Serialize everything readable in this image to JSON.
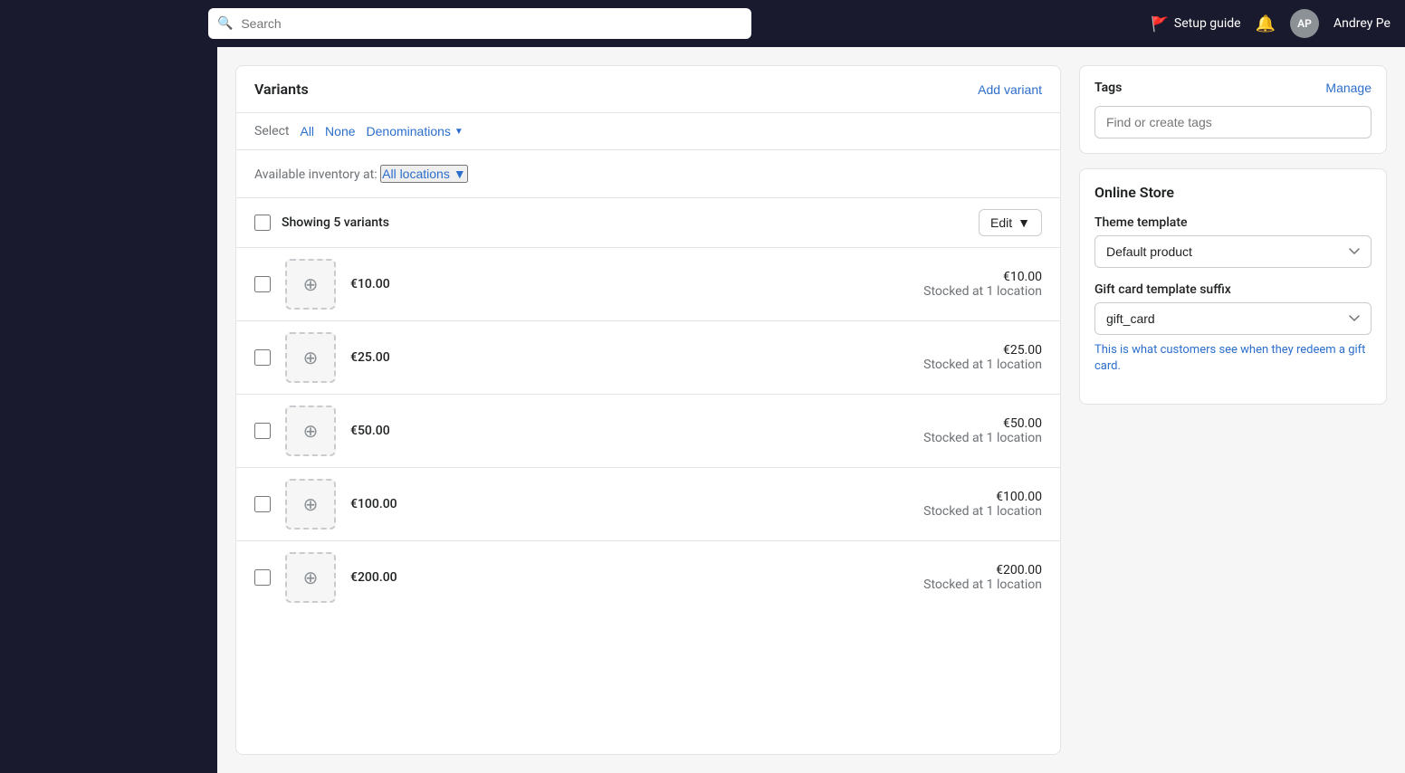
{
  "topNav": {
    "searchPlaceholder": "Search",
    "setupGuideLabel": "Setup guide",
    "bellTitle": "Notifications",
    "avatarInitials": "AP",
    "userName": "Andrey Pe"
  },
  "variants": {
    "title": "Variants",
    "addVariantLabel": "Add variant",
    "selectLabel": "Select",
    "allLabel": "All",
    "noneLabel": "None",
    "denominationsLabel": "Denominations",
    "inventoryPrefix": "Available inventory at:",
    "allLocationsLabel": "All locations",
    "showingLabel": "Showing 5 variants",
    "editLabel": "Edit",
    "items": [
      {
        "price": "€10.00",
        "priceRight": "€10.00",
        "stock": "Stocked at 1 location"
      },
      {
        "price": "€25.00",
        "priceRight": "€25.00",
        "stock": "Stocked at 1 location"
      },
      {
        "price": "€50.00",
        "priceRight": "€50.00",
        "stock": "Stocked at 1 location"
      },
      {
        "price": "€100.00",
        "priceRight": "€100.00",
        "stock": "Stocked at 1 location"
      },
      {
        "price": "€200.00",
        "priceRight": "€200.00",
        "stock": "Stocked at 1 location"
      }
    ]
  },
  "tags": {
    "title": "Tags",
    "manageLabel": "Manage",
    "inputPlaceholder": "Find or create tags"
  },
  "onlineStore": {
    "title": "Online Store",
    "themeTemplateLabel": "Theme template",
    "themeTemplateValue": "Default product",
    "themeTemplateOptions": [
      "Default product"
    ],
    "giftCardSuffixLabel": "Gift card template suffix",
    "giftCardSuffixValue": "gift_card",
    "giftCardSuffixOptions": [
      "gift_card"
    ],
    "hintText": "This is what customers see when they redeem a gift card."
  }
}
